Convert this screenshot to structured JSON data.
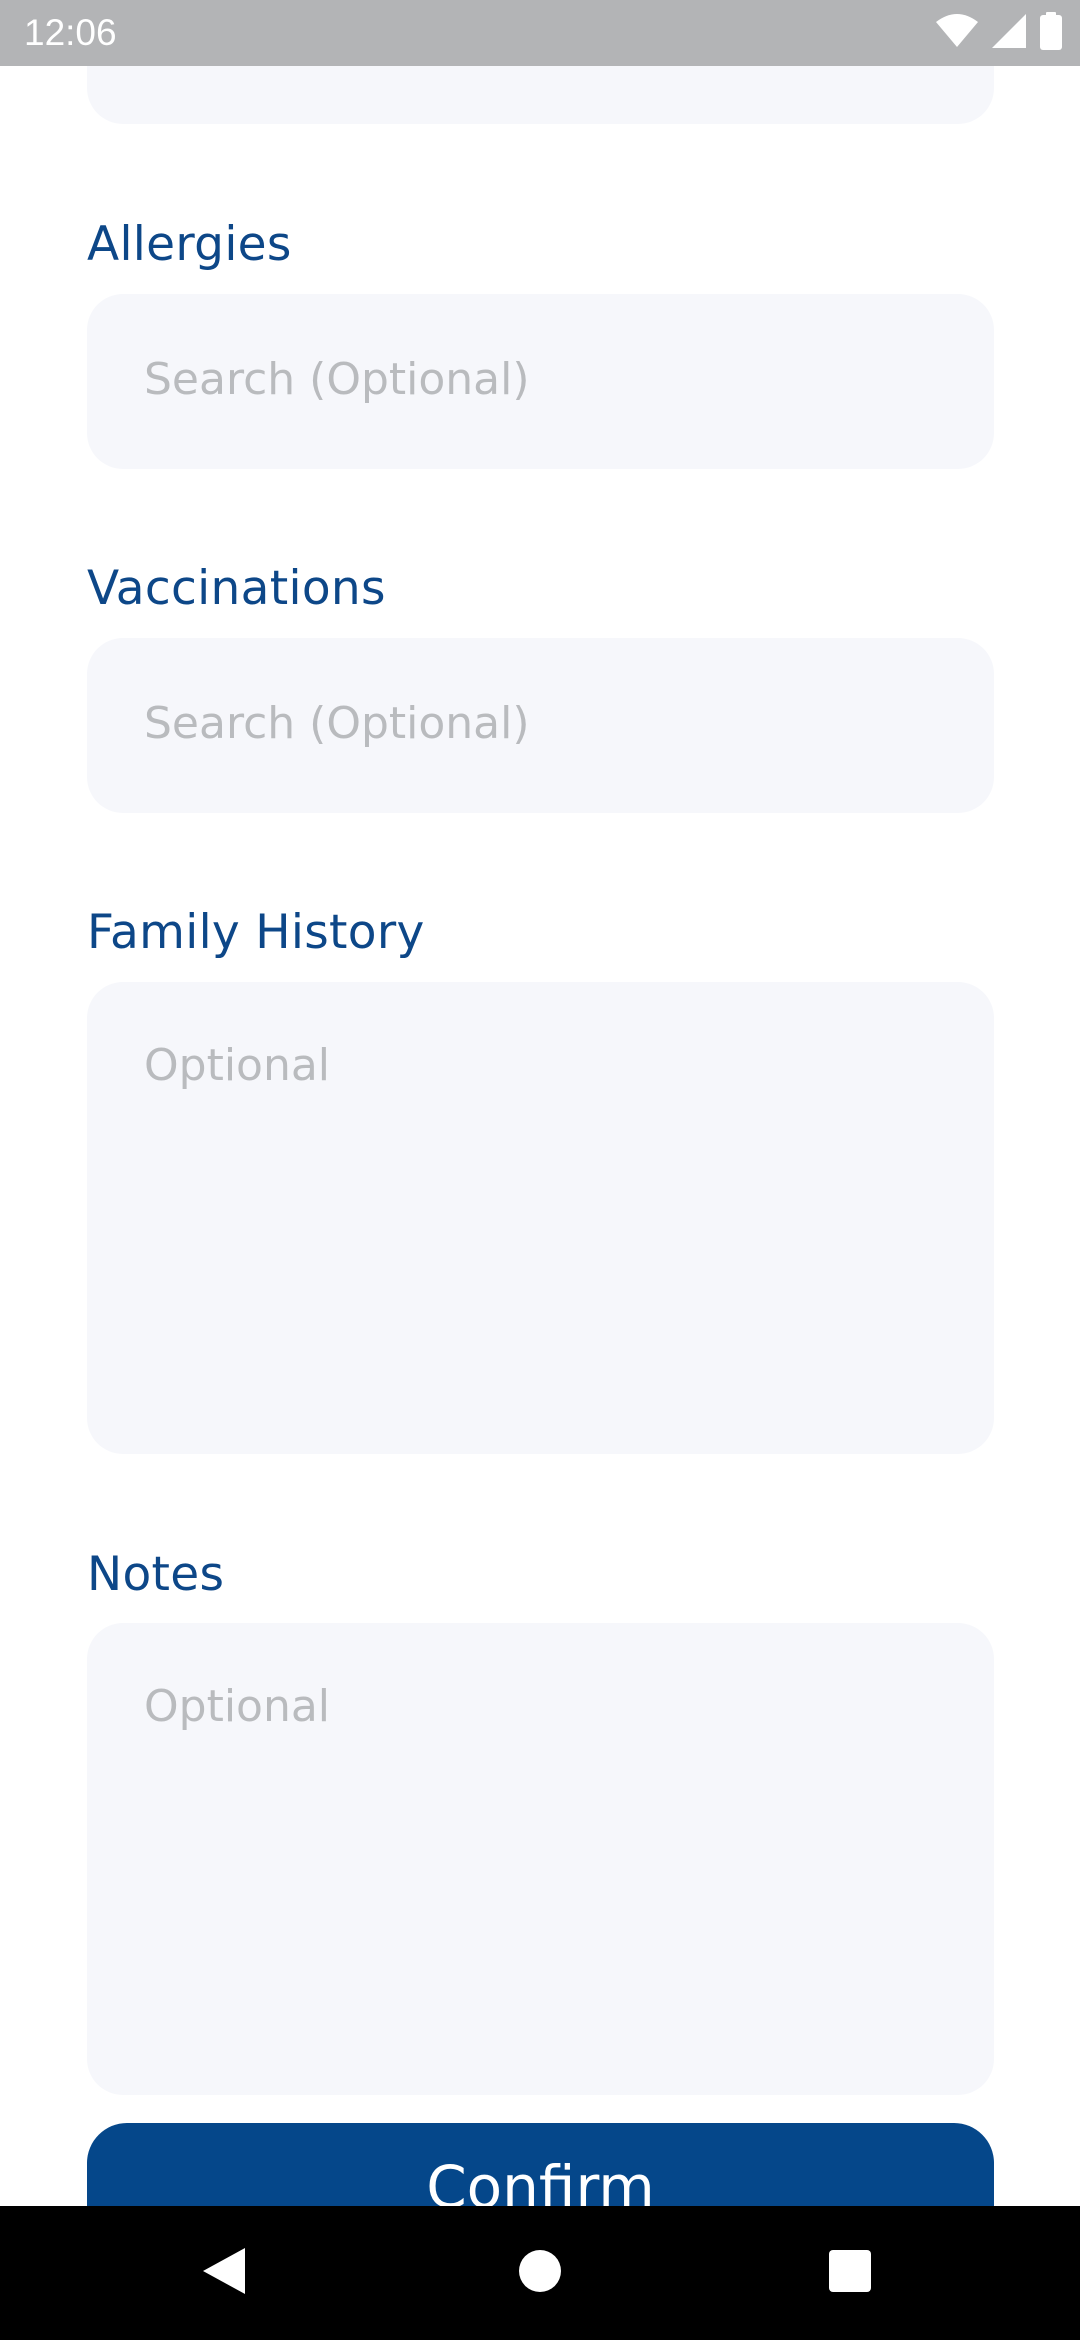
{
  "status_bar": {
    "time": "12:06",
    "icons": [
      "wifi-icon",
      "cellular-signal-icon",
      "battery-icon"
    ]
  },
  "form": {
    "allergies": {
      "label": "Allergies",
      "placeholder": "Search (Optional)",
      "value": ""
    },
    "vaccinations": {
      "label": "Vaccinations",
      "placeholder": "Search (Optional)",
      "value": ""
    },
    "family_history": {
      "label": "Family History",
      "placeholder": "Optional",
      "value": ""
    },
    "notes": {
      "label": "Notes",
      "placeholder": "Optional",
      "value": ""
    },
    "confirm_label": "Confirm"
  },
  "navigation_bar": {
    "icons": [
      "back-icon",
      "home-icon",
      "recents-icon"
    ]
  },
  "colors": {
    "label_blue": "#0d4788",
    "button_blue": "#05478a",
    "field_background": "#f6f7fb",
    "placeholder_gray": "#b9bbbe",
    "status_bar_gray": "#b3b4b6"
  }
}
